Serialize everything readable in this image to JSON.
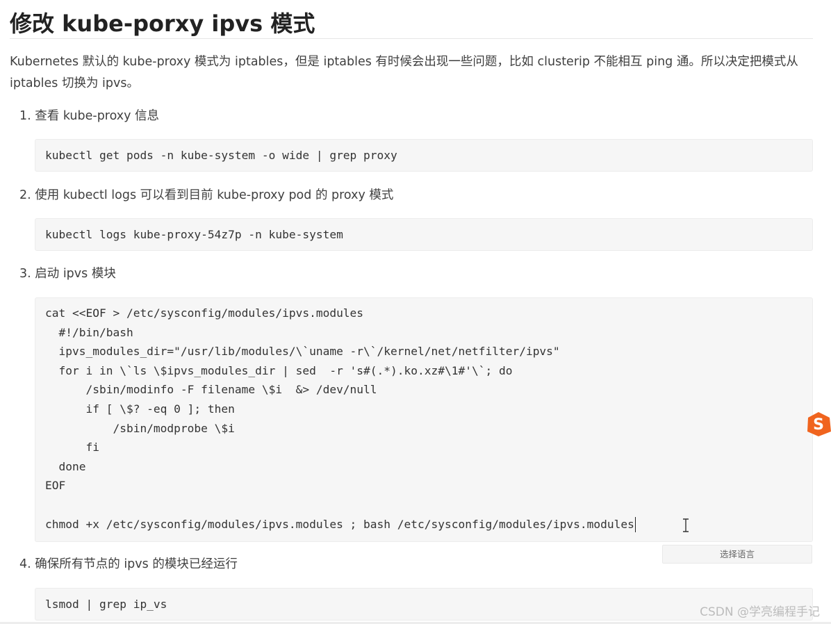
{
  "title": "修改 kube-porxy ipvs 模式",
  "intro": "Kubernetes 默认的 kube-proxy 模式为 iptables，但是 iptables 有时候会出现一些问题，比如 clusterip 不能相互 ping 通。所以决定把模式从 iptables 切换为 ipvs。",
  "steps": [
    {
      "label": "1. 查看 kube-proxy 信息",
      "code": [
        "kubectl get pods -n kube-system -o wide | grep proxy"
      ]
    },
    {
      "label": "2. 使用 kubectl logs 可以看到目前 kube-proxy pod 的 proxy 模式",
      "code": [
        "kubectl logs kube-proxy-54z7p -n kube-system"
      ]
    },
    {
      "label": "3. 启动 ipvs 模块",
      "code": [
        "cat <<EOF > /etc/sysconfig/modules/ipvs.modules",
        "  #!/bin/bash",
        "  ipvs_modules_dir=\"/usr/lib/modules/\\`uname -r\\`/kernel/net/netfilter/ipvs\"",
        "  for i in \\`ls \\$ipvs_modules_dir | sed  -r 's#(.*).ko.xz#\\1#'\\`; do",
        "      /sbin/modinfo -F filename \\$i  &> /dev/null",
        "      if [ \\$? -eq 0 ]; then",
        "          /sbin/modprobe \\$i",
        "      fi",
        "  done",
        "EOF",
        "",
        "chmod +x /etc/sysconfig/modules/ipvs.modules ; bash /etc/sysconfig/modules/ipvs.modules"
      ]
    },
    {
      "label": "4. 确保所有节点的 ipvs 的模块已经运行",
      "code": [
        "lsmod | grep ip_vs"
      ]
    }
  ],
  "language_button": "选择语言",
  "watermark": "CSDN @学亮编程手记",
  "icons": {
    "ime": "sogou-ime-icon",
    "cursor": "text-cursor-icon"
  },
  "colors": {
    "code_bg": "#f6f6f6",
    "ime_orange": "#f0641e"
  }
}
